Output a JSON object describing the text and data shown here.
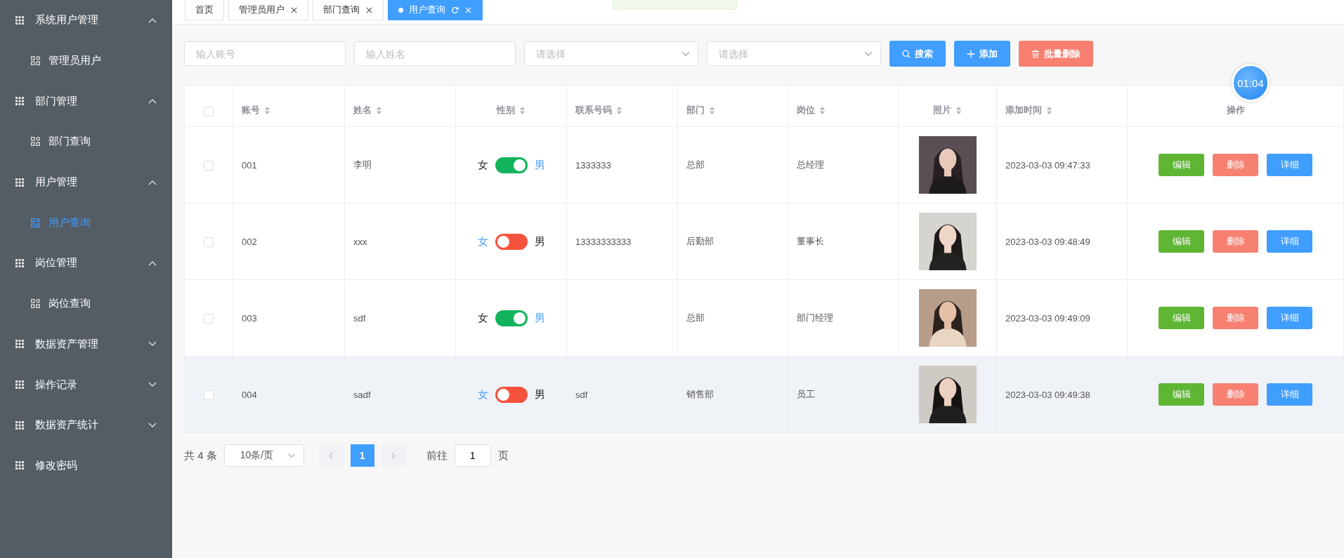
{
  "sidebar": {
    "items": [
      {
        "label": "系统用户管理",
        "expanded": true,
        "children": [
          {
            "label": "管理员用户",
            "selected": false
          }
        ]
      },
      {
        "label": "部门管理",
        "expanded": true,
        "children": [
          {
            "label": "部门查询",
            "selected": false
          }
        ]
      },
      {
        "label": "用户管理",
        "expanded": true,
        "children": [
          {
            "label": "用户查询",
            "selected": true
          }
        ]
      },
      {
        "label": "岗位管理",
        "expanded": true,
        "children": [
          {
            "label": "岗位查询",
            "selected": false
          }
        ]
      },
      {
        "label": "数据资产管理",
        "expanded": false
      },
      {
        "label": "操作记录",
        "expanded": false
      },
      {
        "label": "数据资产统计",
        "expanded": false
      },
      {
        "label": "修改密码"
      }
    ]
  },
  "tabs": [
    {
      "label": "首页",
      "selected": false,
      "closable": false
    },
    {
      "label": "管理员用户",
      "selected": false,
      "closable": true
    },
    {
      "label": "部门查询",
      "selected": false,
      "closable": true
    },
    {
      "label": "用户查询",
      "selected": true,
      "closable": true
    }
  ],
  "filters": [
    {
      "kind": "input",
      "placeholder": "输入账号"
    },
    {
      "kind": "input",
      "placeholder": "输入姓名"
    },
    {
      "kind": "select",
      "placeholder": "请选择"
    },
    {
      "kind": "select",
      "placeholder": "请选择"
    }
  ],
  "toolbar_buttons": [
    {
      "kind": "search",
      "label": "搜索"
    },
    {
      "kind": "add",
      "label": "添加"
    },
    {
      "kind": "delete",
      "label": "批量删除"
    }
  ],
  "timer_badge": "01:04",
  "table": {
    "all_selected": false,
    "columns": [
      {
        "label": "账号",
        "sortable": true
      },
      {
        "label": "姓名",
        "sortable": true
      },
      {
        "label": "性别",
        "sortable": true
      },
      {
        "label": "联系号码",
        "sortable": true
      },
      {
        "label": "部门",
        "sortable": true
      },
      {
        "label": "岗位",
        "sortable": true
      },
      {
        "label": "照片",
        "sortable": true
      },
      {
        "label": "添加时间",
        "sortable": true
      },
      {
        "label": "操作",
        "sortable": false
      }
    ],
    "rows": [
      {
        "selected": false,
        "hovered": false,
        "account": "001",
        "name": "李明",
        "switch_off_label": "女",
        "switch_on_label": "男",
        "on": true,
        "phone": "1333333",
        "department": "总部",
        "position": "总经理",
        "photo": {
          "kind": "picture"
        },
        "added": "2023-03-03 09:47:33",
        "actions": [
          {
            "kind": "edit",
            "label": "编辑"
          },
          {
            "kind": "delete",
            "label": "删除"
          },
          {
            "kind": "detail",
            "label": "详细"
          }
        ]
      },
      {
        "selected": false,
        "hovered": false,
        "account": "002",
        "name": "xxx",
        "switch_off_label": "女",
        "switch_on_label": "男",
        "on": false,
        "phone": "13333333333",
        "department": "后勤部",
        "position": "董事长",
        "photo": {
          "kind": "picture"
        },
        "added": "2023-03-03 09:48:49",
        "actions": [
          {
            "kind": "edit",
            "label": "编辑"
          },
          {
            "kind": "delete",
            "label": "删除"
          },
          {
            "kind": "detail",
            "label": "详细"
          }
        ]
      },
      {
        "selected": false,
        "hovered": false,
        "account": "003",
        "name": "sdf",
        "switch_off_label": "女",
        "switch_on_label": "男",
        "on": true,
        "phone": "",
        "department": "总部",
        "position": "部门经理",
        "photo": {
          "kind": "picture"
        },
        "added": "2023-03-03 09:49:09",
        "actions": [
          {
            "kind": "edit",
            "label": "编辑"
          },
          {
            "kind": "delete",
            "label": "删除"
          },
          {
            "kind": "detail",
            "label": "详细"
          }
        ]
      },
      {
        "selected": false,
        "hovered": true,
        "account": "004",
        "name": "sadf",
        "switch_off_label": "女",
        "switch_on_label": "男",
        "on": false,
        "phone": "sdf",
        "department": "销售部",
        "position": "员工",
        "photo": {
          "kind": "picture"
        },
        "added": "2023-03-03 09:49:38",
        "actions": [
          {
            "kind": "edit",
            "label": "编辑"
          },
          {
            "kind": "delete",
            "label": "删除"
          },
          {
            "kind": "detail",
            "label": "详细"
          }
        ]
      }
    ]
  },
  "pagination": {
    "total": "共 4 条",
    "page_size": "10条/页",
    "pages": [
      {
        "label": "1",
        "selected": true
      }
    ],
    "goto_label": "前往",
    "goto_value": "1",
    "goto_suffix": "页"
  }
}
